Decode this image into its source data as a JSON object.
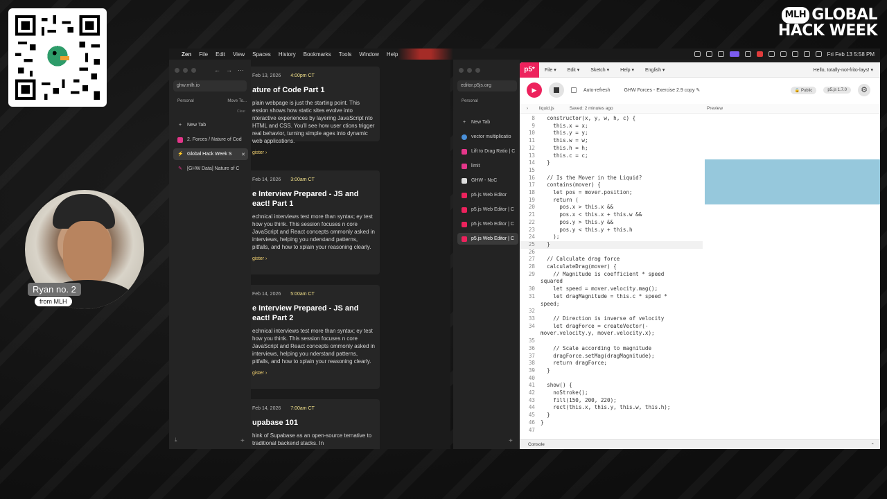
{
  "colors": {
    "accent": "#ed225d",
    "preview_rect": "#96c8dc",
    "event_time": "#f2e18a"
  },
  "logo": {
    "badge": "MLH",
    "line1": "GLOBAL",
    "line2": "HACK WEEK"
  },
  "presenter": {
    "name": "Ryan no. 2",
    "org": "from MLH"
  },
  "menubar": {
    "apple": "",
    "items": [
      "Zen",
      "File",
      "Edit",
      "View",
      "Spaces",
      "History",
      "Bookmarks",
      "Tools",
      "Window",
      "Help"
    ],
    "clock": "Fri Feb 13  5:58 PM"
  },
  "zen": {
    "url": "ghw.mlh.io",
    "space": "Personal",
    "move_to": "Move To...",
    "clear": "Clear",
    "new_tab": "New Tab",
    "tabs": [
      {
        "label": "2. Forces / Nature of Cod"
      },
      {
        "label": "Global Hack Week S"
      },
      {
        "label": "[GHW Data] Nature of C"
      }
    ],
    "events": [
      {
        "date": "Feb 13, 2026",
        "time": "4:00pm CT",
        "title": "ature of Code Part 1",
        "desc": "plain webpage is just the starting point. This ession shows how static sites evolve into nteractive experiences by layering JavaScript nto HTML and CSS. You'll see how user ctions trigger real behavior, turning simple ages into dynamic web applications.",
        "register": "gister ›"
      },
      {
        "date": "Feb 14, 2026",
        "time": "3:00am CT",
        "title": "e Interview Prepared - JS and eact! Part 1",
        "desc": "echnical interviews test more than syntax; ey test how you think. This session focuses n core JavaScript and React concepts ommonly asked in interviews, helping you nderstand patterns, pitfalls, and how to xplain your reasoning clearly.",
        "register": "gister ›"
      },
      {
        "date": "Feb 14, 2026",
        "time": "5:00am CT",
        "title": "e Interview Prepared - JS and eact! Part 2",
        "desc": "echnical interviews test more than syntax; ey test how you think. This session focuses n core JavaScript and React concepts ommonly asked in interviews, helping you nderstand patterns, pitfalls, and how to xplain your reasoning clearly.",
        "register": "gister ›"
      },
      {
        "date": "Feb 14, 2026",
        "time": "7:00am CT",
        "title": "upabase 101",
        "desc": "hink of Supabase as an open-source ternative to traditional backend stacks. In",
        "register": ""
      }
    ]
  },
  "browser2": {
    "url": "editor.p5js.org",
    "space": "Personal",
    "new_tab": "New Tab",
    "tabs": [
      "vector multiplicatio",
      "Lift to Drag Ratio | C",
      "limit",
      "GHW - NoC",
      "p5.js Web Editor",
      "p5.js Web Editor | C",
      "p5.js Web Editor | C",
      "p5.js Web Editor | C"
    ]
  },
  "p5": {
    "logo": "p5*",
    "menus": [
      "File ▾",
      "Edit ▾",
      "Sketch ▾",
      "Help ▾",
      "English ▾"
    ],
    "hello": "Hello, totally-not-frito-lays! ▾",
    "auto_refresh": "Auto-refresh",
    "sketch_name": "GHW Forces - Exercise 2.9 copy ✎",
    "public": "🔒 Public",
    "version": "p5.js 1.7.0",
    "file": "liquid.js",
    "saved": "Saved: 2 minutes ago",
    "preview": "Preview",
    "console": "Console",
    "code": [
      {
        "n": "8",
        "t": "  constructor(x, y, w, h, c) {"
      },
      {
        "n": "9",
        "t": "    this.x = x;"
      },
      {
        "n": "10",
        "t": "    this.y = y;"
      },
      {
        "n": "11",
        "t": "    this.w = w;"
      },
      {
        "n": "12",
        "t": "    this.h = h;"
      },
      {
        "n": "13",
        "t": "    this.c = c;"
      },
      {
        "n": "14",
        "t": "  }"
      },
      {
        "n": "15",
        "t": ""
      },
      {
        "n": "16",
        "t": "  // Is the Mover in the Liquid?"
      },
      {
        "n": "17",
        "t": "  contains(mover) {"
      },
      {
        "n": "18",
        "t": "    let pos = mover.position;"
      },
      {
        "n": "19",
        "t": "    return ("
      },
      {
        "n": "20",
        "t": "      pos.x > this.x &&"
      },
      {
        "n": "21",
        "t": "      pos.x < this.x + this.w &&"
      },
      {
        "n": "22",
        "t": "      pos.y > this.y &&"
      },
      {
        "n": "23",
        "t": "      pos.y < this.y + this.h"
      },
      {
        "n": "24",
        "t": "    );"
      },
      {
        "n": "25",
        "t": "  }"
      },
      {
        "n": "26",
        "t": ""
      },
      {
        "n": "27",
        "t": "  // Calculate drag force"
      },
      {
        "n": "28",
        "t": "  calculateDrag(mover) {"
      },
      {
        "n": "29",
        "t": "    // Magnitude is coefficient * speed"
      },
      {
        "n": "",
        "t": "squared"
      },
      {
        "n": "30",
        "t": "    let speed = mover.velocity.mag();"
      },
      {
        "n": "31",
        "t": "    let dragMagnitude = this.c * speed *"
      },
      {
        "n": "",
        "t": "speed;"
      },
      {
        "n": "32",
        "t": ""
      },
      {
        "n": "33",
        "t": "    // Direction is inverse of velocity"
      },
      {
        "n": "34",
        "t": "    let dragForce = createVector(-"
      },
      {
        "n": "",
        "t": "mover.velocity.y, mover.velocity.x);"
      },
      {
        "n": "35",
        "t": ""
      },
      {
        "n": "36",
        "t": "    // Scale according to magnitude"
      },
      {
        "n": "37",
        "t": "    dragForce.setMag(dragMagnitude);"
      },
      {
        "n": "38",
        "t": "    return dragForce;"
      },
      {
        "n": "39",
        "t": "  }"
      },
      {
        "n": "40",
        "t": ""
      },
      {
        "n": "41",
        "t": "  show() {"
      },
      {
        "n": "42",
        "t": "    noStroke();"
      },
      {
        "n": "43",
        "t": "    fill(150, 200, 220);"
      },
      {
        "n": "44",
        "t": "    rect(this.x, this.y, this.w, this.h);"
      },
      {
        "n": "45",
        "t": "  }"
      },
      {
        "n": "46",
        "t": "}"
      },
      {
        "n": "47",
        "t": ""
      }
    ]
  }
}
